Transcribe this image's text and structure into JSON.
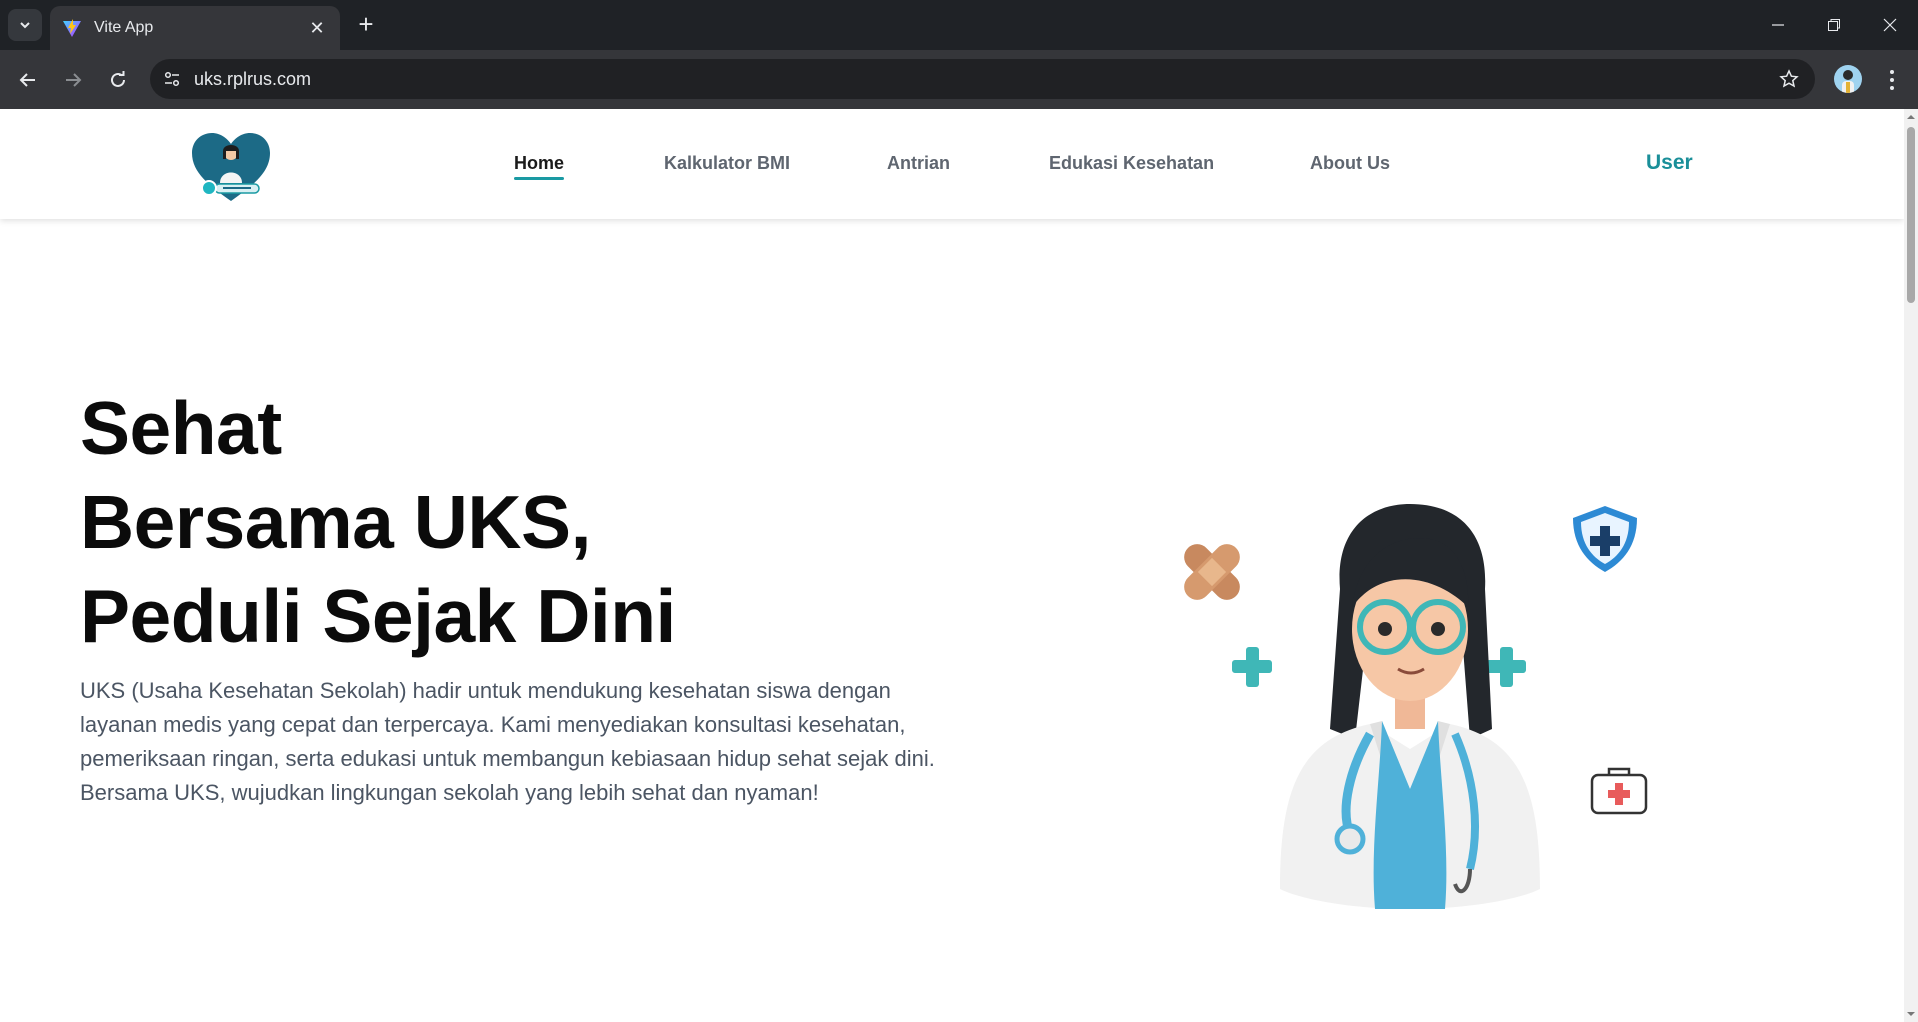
{
  "browser": {
    "tab_title": "Vite App",
    "url": "uks.rplrus.com"
  },
  "nav": {
    "items": [
      {
        "label": "Home",
        "active": true
      },
      {
        "label": "Kalkulator BMI",
        "active": false
      },
      {
        "label": "Antrian",
        "active": false
      },
      {
        "label": "Edukasi Kesehatan",
        "active": false
      },
      {
        "label": "About Us",
        "active": false
      }
    ],
    "user_label": "User"
  },
  "hero": {
    "title_lines": [
      "Sehat",
      "Bersama UKS,",
      "Peduli Sejak Dini"
    ],
    "description": "UKS (Usaha Kesehatan Sekolah) hadir untuk mendukung kesehatan siswa dengan layanan medis yang cepat dan terpercaya. Kami menyediakan konsultasi kesehatan, pemeriksaan ringan, serta edukasi untuk membangun kebiasaan hidup sehat sejak dini. Bersama UKS, wujudkan lingkungan sekolah yang lebih sehat dan nyaman!"
  },
  "colors": {
    "accent": "#1a9aa3",
    "browser_bg": "#1f2226",
    "toolbar_bg": "#35363a"
  },
  "icons": [
    "tab-search-icon",
    "vite-favicon-icon",
    "close-icon",
    "plus-icon",
    "minimize-icon",
    "restore-icon",
    "window-close-icon",
    "back-icon",
    "forward-icon",
    "reload-icon",
    "site-info-icon",
    "star-icon",
    "profile-avatar-icon",
    "menu-icon"
  ]
}
